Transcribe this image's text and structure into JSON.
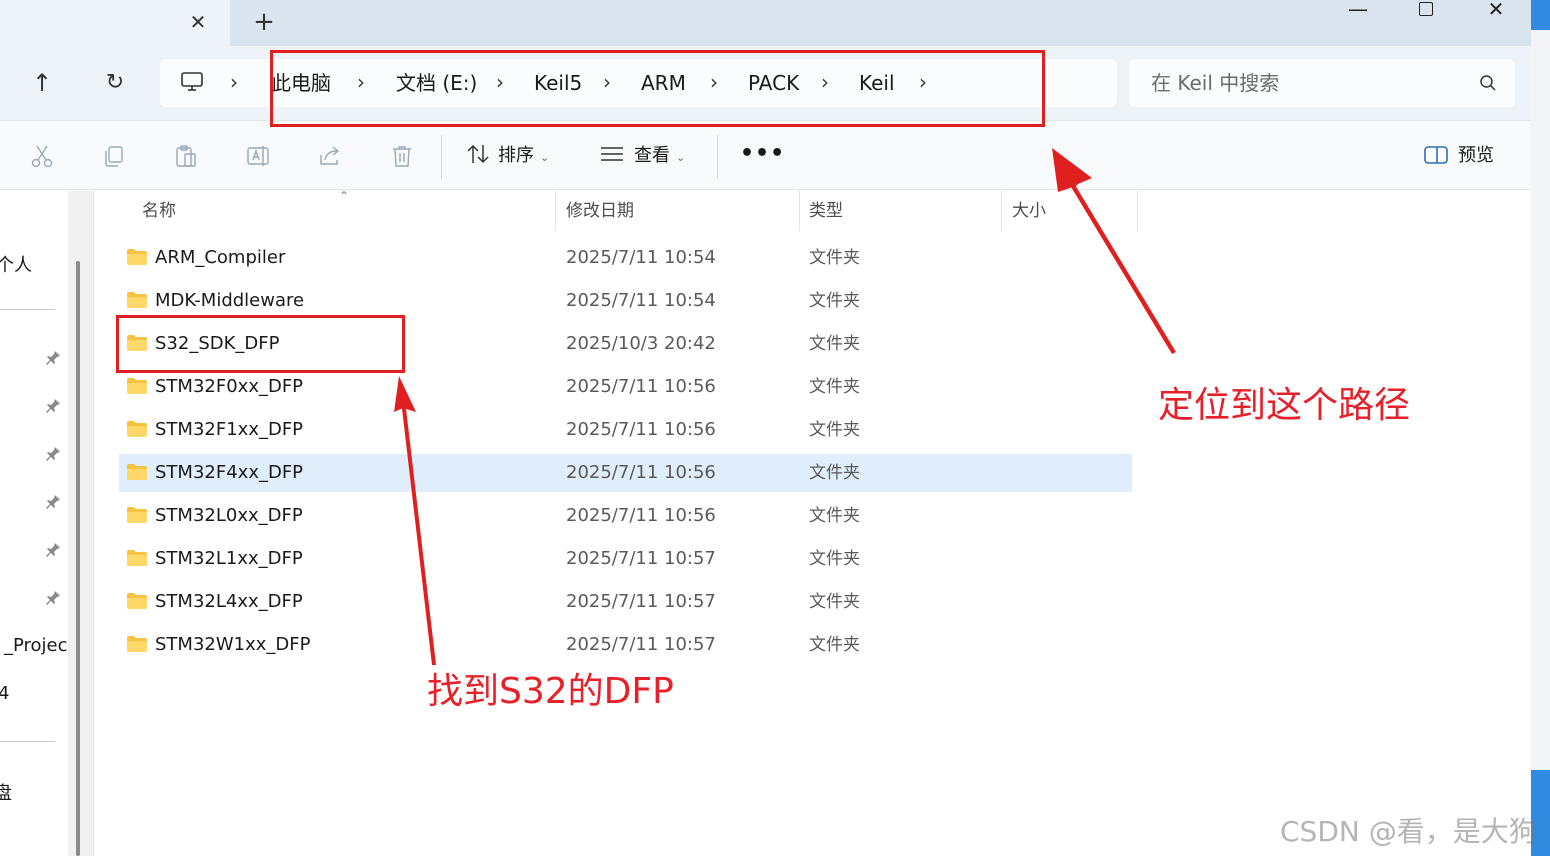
{
  "window": {
    "tab_close": "✕",
    "new_tab": "+",
    "minimize": "—",
    "close": "✕"
  },
  "nav": {
    "up": "↑",
    "refresh": "↻"
  },
  "breadcrumb": {
    "separator": "›",
    "items": [
      "此电脑",
      "文档 (E:)",
      "Keil5",
      "ARM",
      "PACK",
      "Keil"
    ]
  },
  "search": {
    "placeholder": "在 Keil 中搜索"
  },
  "toolbar": {
    "sort_label": "排序",
    "view_label": "查看",
    "more_label": "•••",
    "preview_label": "预览"
  },
  "sidebar": {
    "items": [
      "个人",
      "_Project",
      "4",
      "盘"
    ]
  },
  "columns": {
    "name": "名称",
    "modified": "修改日期",
    "type": "类型",
    "size": "大小"
  },
  "files": [
    {
      "name": "ARM_Compiler",
      "modified": "2025/7/11 10:54",
      "type": "文件夹"
    },
    {
      "name": "MDK-Middleware",
      "modified": "2025/7/11 10:54",
      "type": "文件夹"
    },
    {
      "name": "S32_SDK_DFP",
      "modified": "2025/10/3 20:42",
      "type": "文件夹"
    },
    {
      "name": "STM32F0xx_DFP",
      "modified": "2025/7/11 10:56",
      "type": "文件夹"
    },
    {
      "name": "STM32F1xx_DFP",
      "modified": "2025/7/11 10:56",
      "type": "文件夹"
    },
    {
      "name": "STM32F4xx_DFP",
      "modified": "2025/7/11 10:56",
      "type": "文件夹",
      "selected": true
    },
    {
      "name": "STM32L0xx_DFP",
      "modified": "2025/7/11 10:56",
      "type": "文件夹"
    },
    {
      "name": "STM32L1xx_DFP",
      "modified": "2025/7/11 10:57",
      "type": "文件夹"
    },
    {
      "name": "STM32L4xx_DFP",
      "modified": "2025/7/11 10:57",
      "type": "文件夹"
    },
    {
      "name": "STM32W1xx_DFP",
      "modified": "2025/7/11 10:57",
      "type": "文件夹"
    }
  ],
  "annotations": {
    "path_note": "定位到这个路径",
    "dfp_note": "找到S32的DFP",
    "color": "#e02020"
  },
  "watermark": "CSDN @看，是大狗",
  "colors": {
    "titlebar": "#d9e4ee",
    "addressrow": "#eef3f8",
    "selection": "#e0eefb",
    "folder": "#f5c242",
    "accent": "#2f8ae0"
  }
}
